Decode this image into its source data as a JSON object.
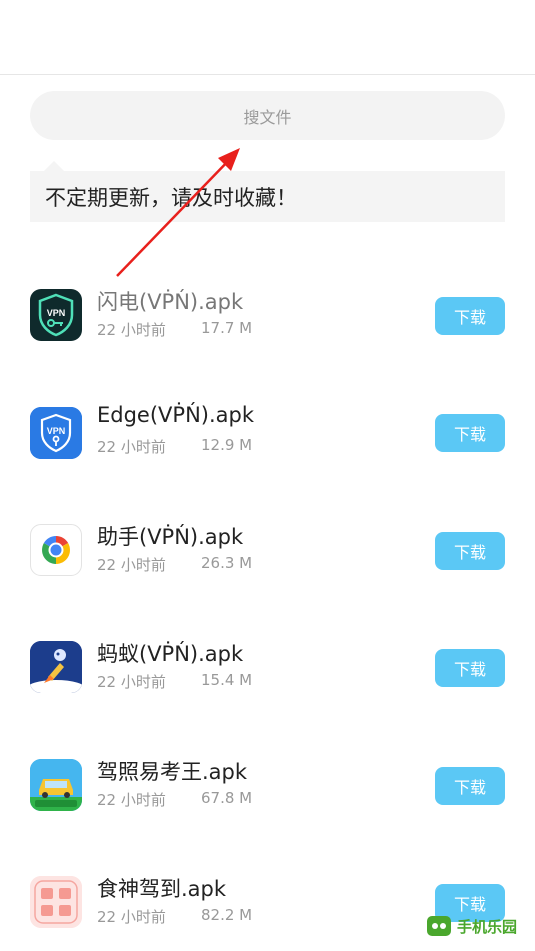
{
  "search": {
    "placeholder": "搜文件"
  },
  "notice": {
    "text": "不定期更新，请及时收藏！"
  },
  "download_label": "下载",
  "files": [
    {
      "name": "闪电(VṖŃ).apk",
      "age": "22 小时前",
      "size": "17.7 M",
      "icon": "vpn-shield-key-icon",
      "name_color": "#777777"
    },
    {
      "name": "Edge(VṖŃ).apk",
      "age": "22 小时前",
      "size": "12.9 M",
      "icon": "vpn-shield-blue-icon",
      "name_color": "#222222"
    },
    {
      "name": "助手(VṖŃ).apk",
      "age": "22 小时前",
      "size": "26.3 M",
      "icon": "colorful-ring-icon",
      "name_color": "#222222"
    },
    {
      "name": "蚂蚁(VṖŃ).apk",
      "age": "22 小时前",
      "size": "15.4 M",
      "icon": "ant-rocket-icon",
      "name_color": "#222222"
    },
    {
      "name": "驾照易考王.apk",
      "age": "22 小时前",
      "size": "67.8 M",
      "icon": "driving-car-icon",
      "name_color": "#222222"
    },
    {
      "name": "食神驾到.apk",
      "age": "22 小时前",
      "size": "82.2 M",
      "icon": "diet-recipe-icon",
      "name_color": "#222222"
    }
  ],
  "watermark": {
    "text": "手机乐园"
  },
  "colors": {
    "download_button": "#5bc8f5",
    "arrow": "#e8201c"
  }
}
